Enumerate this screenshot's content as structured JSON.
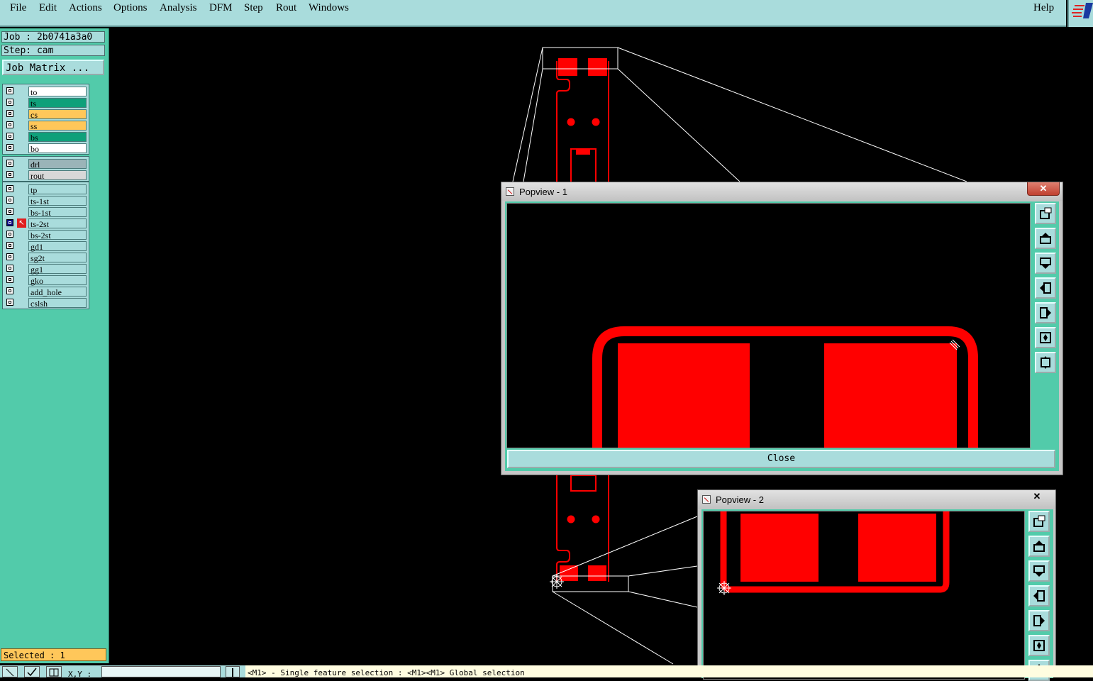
{
  "menu": {
    "items": [
      "File",
      "Edit",
      "Actions",
      "Options",
      "Analysis",
      "DFM",
      "Step",
      "Rout",
      "Windows"
    ],
    "help": "Help"
  },
  "job": {
    "label": "Job : 2b0741a3a0",
    "step": "Step: cam"
  },
  "job_matrix_button": "Job Matrix ...",
  "layers": {
    "group1": [
      {
        "name": "to",
        "color": "#ffffff"
      },
      {
        "name": "ts",
        "color": "#0fa07a"
      },
      {
        "name": "cs",
        "color": "#ffc75a"
      },
      {
        "name": "ss",
        "color": "#ffc75a"
      },
      {
        "name": "bs",
        "color": "#0fa07a"
      },
      {
        "name": "bo",
        "color": "#ffffff"
      }
    ],
    "group2": [
      {
        "name": "drl",
        "color": "#9ab4b8"
      },
      {
        "name": "rout",
        "color": "#d8d8d8"
      }
    ],
    "group3": [
      {
        "name": "tp",
        "color": "#a9dcdc"
      },
      {
        "name": "ts-1st",
        "color": "#a9dcdc"
      },
      {
        "name": "bs-1st",
        "color": "#a9dcdc"
      },
      {
        "name": "ts-2st",
        "color": "#a9dcdc",
        "active": true
      },
      {
        "name": "bs-2st",
        "color": "#a9dcdc"
      },
      {
        "name": "gd1",
        "color": "#a9dcdc"
      },
      {
        "name": "sg2t",
        "color": "#a9dcdc"
      },
      {
        "name": "gg1",
        "color": "#a9dcdc"
      },
      {
        "name": "gko",
        "color": "#a9dcdc"
      },
      {
        "name": "add_hole",
        "color": "#a9dcdc"
      },
      {
        "name": "cslsh",
        "color": "#a9dcdc"
      }
    ]
  },
  "selected": "Selected : 1",
  "status": {
    "xy_label": "X,Y :",
    "message": "<M1> - Single feature selection : <M1><M1> Global selection"
  },
  "popview1": {
    "title": "Popview - 1",
    "close_label": "Close",
    "close_x": "✕"
  },
  "popview2": {
    "title": "Popview - 2",
    "close_x": "✕"
  },
  "colors": {
    "feature": "#ff0000",
    "menu_bg": "#a9dcdc",
    "panel_bg": "#52cbaa",
    "selected_bg": "#ffc75a"
  },
  "icons": [
    "zoom-home-icon",
    "pan-up-icon",
    "pan-down-icon",
    "pan-left-icon",
    "pan-right-icon",
    "zoom-out-icon",
    "zoom-fit-icon"
  ]
}
